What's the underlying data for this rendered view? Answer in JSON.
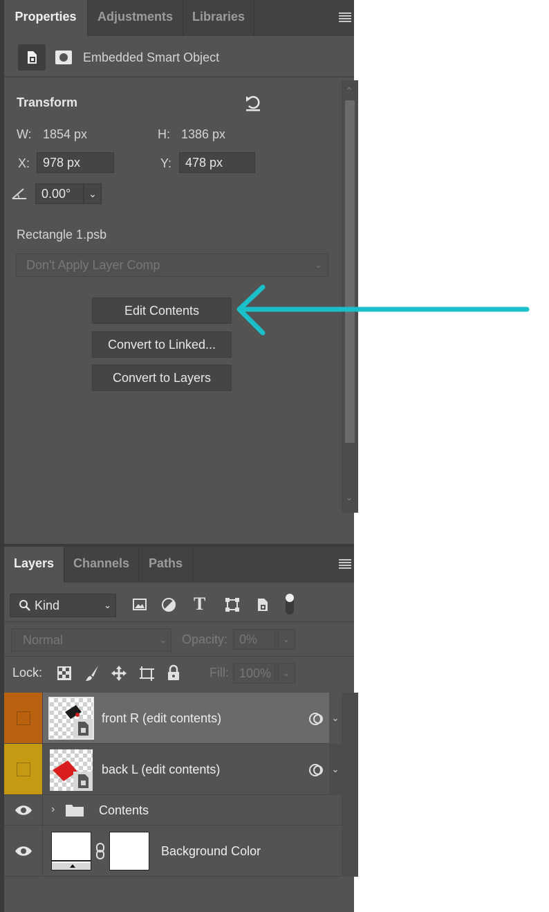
{
  "properties_panel": {
    "tabs": [
      "Properties",
      "Adjustments",
      "Libraries"
    ],
    "header_label": "Embedded Smart Object",
    "transform": {
      "title": "Transform",
      "w_label": "W:",
      "w_value": "1854 px",
      "h_label": "H:",
      "h_value": "1386 px",
      "x_label": "X:",
      "x_value": "978 px",
      "y_label": "Y:",
      "y_value": "478 px",
      "angle_value": "0.00°"
    },
    "file_name": "Rectangle 1.psb",
    "layer_comp": "Don't Apply Layer Comp",
    "buttons": {
      "edit_contents": "Edit Contents",
      "convert_linked": "Convert to Linked...",
      "convert_layers": "Convert to Layers"
    }
  },
  "annotation": {
    "arrow_color": "#1bbfc9"
  },
  "layers_panel": {
    "tabs": [
      "Layers",
      "Channels",
      "Paths"
    ],
    "filter_kind": "Kind",
    "blend_mode": "Normal",
    "opacity_label": "Opacity:",
    "opacity_value": "0%",
    "lock_label": "Lock:",
    "fill_label": "Fill:",
    "fill_value": "100%",
    "layers": [
      {
        "name": "front R (edit contents)",
        "color_tag": "#b8620f",
        "selected": true
      },
      {
        "name": "back L (edit contents)",
        "color_tag": "#c49a12",
        "selected": false
      },
      {
        "name": "Contents",
        "type": "group"
      },
      {
        "name": "Background Color",
        "type": "fill"
      }
    ]
  }
}
